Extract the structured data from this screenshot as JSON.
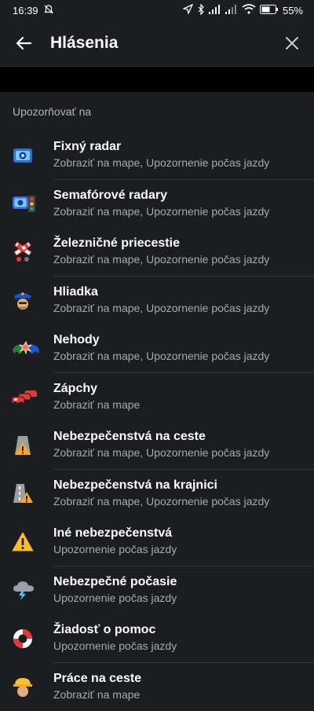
{
  "status_bar": {
    "time": "16:39",
    "battery": "55%"
  },
  "app_bar": {
    "title": "Hlásenia"
  },
  "section": {
    "label": "Upozorňovať na"
  },
  "items": [
    {
      "title": "Fixný radar",
      "subtitle": "Zobraziť na mape, Upozornenie počas jazdy",
      "icon": "fixed-radar-icon"
    },
    {
      "title": "Semafórové radary",
      "subtitle": "Zobraziť na mape, Upozornenie počas jazdy",
      "icon": "traffic-light-radar-icon"
    },
    {
      "title": "Železničné priecestie",
      "subtitle": "Zobraziť na mape, Upozornenie počas jazdy",
      "icon": "railway-crossing-icon"
    },
    {
      "title": "Hliadka",
      "subtitle": "Zobraziť na mape, Upozornenie počas jazdy",
      "icon": "police-icon"
    },
    {
      "title": "Nehody",
      "subtitle": "Zobraziť na mape, Upozornenie počas jazdy",
      "icon": "crash-icon"
    },
    {
      "title": "Zápchy",
      "subtitle": "Zobraziť na mape",
      "icon": "traffic-jam-icon"
    },
    {
      "title": "Nebezpečenstvá na ceste",
      "subtitle": "Zobraziť na mape, Upozornenie počas jazdy",
      "icon": "road-hazard-icon"
    },
    {
      "title": "Nebezpečenstvá na krajnici",
      "subtitle": "Zobraziť na mape, Upozornenie počas jazdy",
      "icon": "shoulder-hazard-icon"
    },
    {
      "title": "Iné nebezpečenstvá",
      "subtitle": "Upozornenie počas jazdy",
      "icon": "warning-icon"
    },
    {
      "title": "Nebezpečné počasie",
      "subtitle": "Upozornenie počas jazdy",
      "icon": "weather-icon"
    },
    {
      "title": "Žiadosť o pomoc",
      "subtitle": "Upozornenie počas jazdy",
      "icon": "lifebuoy-icon"
    },
    {
      "title": "Práce na ceste",
      "subtitle": "Zobraziť na mape",
      "icon": "roadworks-icon"
    }
  ]
}
